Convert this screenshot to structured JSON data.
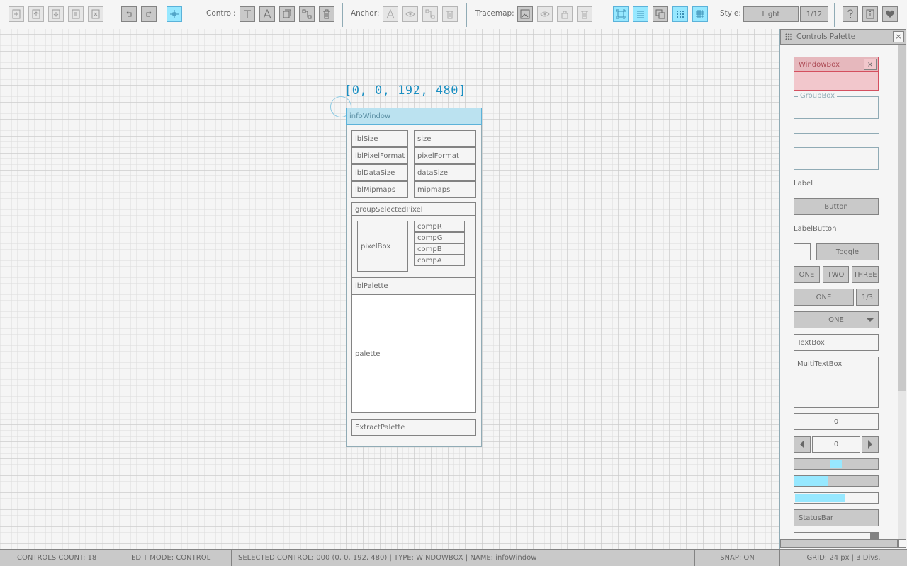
{
  "toolbar": {
    "control_label": "Control:",
    "anchor_label": "Anchor:",
    "tracemap_label": "Tracemap:",
    "style_label": "Style:",
    "style_value": "Light",
    "style_page": "1/12"
  },
  "canvas": {
    "coords": "[0, 0, 192, 480]",
    "window_title": "infoWindow",
    "controls": {
      "lblSize": "lblSize",
      "size": "size",
      "lblPixelFormat": "lblPixelFormat",
      "pixelFormat": "pixelFormat",
      "lblDataSize": "lblDataSize",
      "dataSize": "dataSize",
      "lblMipmaps": "lblMipmaps",
      "mipmaps": "mipmaps",
      "groupSelectedPixel": "groupSelectedPixel",
      "pixelBox": "pixelBox",
      "compR": "compR",
      "compG": "compG",
      "compB": "compB",
      "compA": "compA",
      "lblPalette": "lblPalette",
      "palette": "palette",
      "extractPalette": "ExtractPalette"
    }
  },
  "palette_panel": {
    "title": "Controls Palette",
    "close": "×",
    "windowbox": "WindowBox",
    "windowbox_close": "×",
    "groupbox": "GroupBox",
    "label": "Label",
    "button": "Button",
    "labelbutton": "LabelButton",
    "toggle": "Toggle",
    "toggle_group": [
      "ONE",
      "TWO",
      "THREE"
    ],
    "combo_value": "ONE",
    "combo_page": "1/3",
    "dropdown_value": "ONE",
    "textbox": "TextBox",
    "multitextbox": "MultiTextBox",
    "valuebox": "0",
    "spinner": "0",
    "statusbar": "StatusBar"
  },
  "status": {
    "controls_count": "CONTROLS COUNT: 18",
    "edit_mode": "EDIT MODE: CONTROL",
    "selected": "SELECTED CONTROL: 000  (0, 0, 192, 480)  | TYPE: WINDOWBOX | NAME: infoWindow",
    "snap": "SNAP: ON",
    "grid": "GRID: 24 px | 3 Divs."
  },
  "colors": {
    "accent": "#97e8ff",
    "accent_border": "#5bb2d9",
    "window_title_bg": "#bbe2f0",
    "coords_text": "#1a8fc2",
    "windowbox_sample": "#f2c7cc",
    "windowbox_border": "#d4505f"
  },
  "widgets": {
    "slider_level": 0.5,
    "sliderbar_level": 0.4,
    "progress_level": 0.6
  }
}
